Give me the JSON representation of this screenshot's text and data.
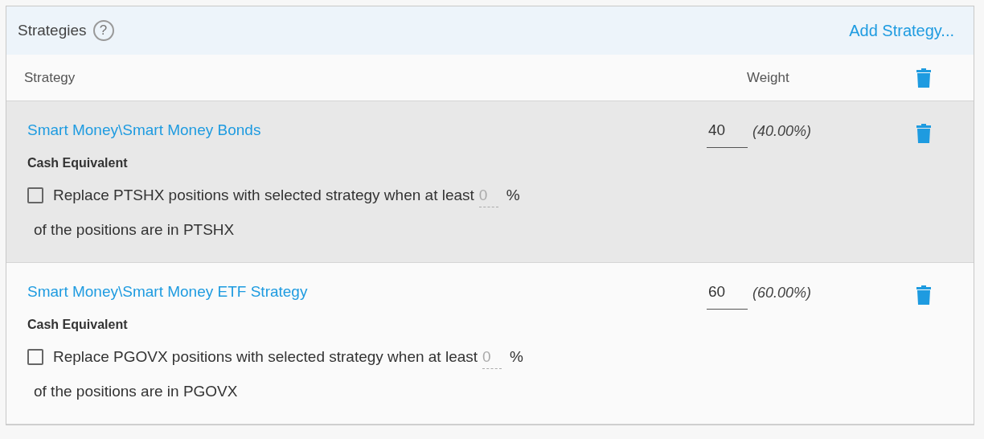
{
  "panel": {
    "title": "Strategies",
    "help_icon": "?",
    "add_link": "Add Strategy..."
  },
  "columns": {
    "strategy": "Strategy",
    "weight": "Weight"
  },
  "rows": [
    {
      "name": "Smart Money\\Smart Money Bonds",
      "category": "Cash Equivalent",
      "checked": false,
      "option_text": "Replace PTSHX positions with selected strategy when at least",
      "threshold_placeholder": "0",
      "unit": "%",
      "option_text_2": "of the positions are in PTSHX",
      "weight": "40",
      "percent": "(40.00%)",
      "selected": true
    },
    {
      "name": "Smart Money\\Smart Money ETF Strategy",
      "category": "Cash Equivalent",
      "checked": false,
      "option_text": "Replace PGOVX positions with selected strategy when at least",
      "threshold_placeholder": "0",
      "unit": "%",
      "option_text_2": "of the positions are in PGOVX",
      "weight": "60",
      "percent": "(60.00%)",
      "selected": false
    }
  ]
}
